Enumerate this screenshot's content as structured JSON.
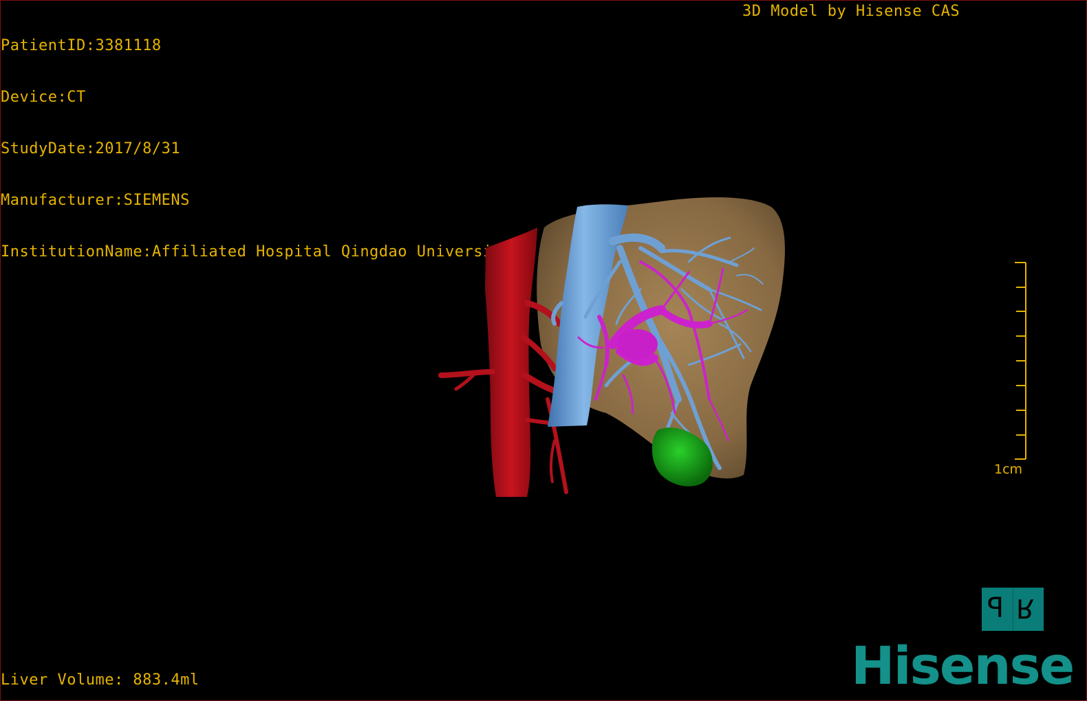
{
  "dicom_info": {
    "patient_id": "PatientID:3381118",
    "device": "Device:CT",
    "study_date": "StudyDate:2017/8/31",
    "manufacturer": "Manufacturer:SIEMENS",
    "institution": "InstitutionName:Affiliated Hospital Qingdao University-C"
  },
  "model_credit": "3D Model by Hisense CAS",
  "liver_volume": "Liver Volume: 883.4ml",
  "scale_bar": {
    "label": "1cm",
    "tick_count": 9
  },
  "orientation_cube": {
    "left_face": "P",
    "right_face": "R"
  },
  "brand": "Hisense",
  "colors": {
    "overlay_text": "#e6b400",
    "liver": "#8c6e45",
    "portal_vein": "#6fa3d8",
    "artery": "#b01020",
    "hepatic_vessel": "#cc22cc",
    "lesion": "#1aa01a",
    "brand": "#13918a",
    "orientation_cube": "#0a7d78"
  },
  "icons": [
    "orientation-cube-icon",
    "hisense-logo"
  ]
}
